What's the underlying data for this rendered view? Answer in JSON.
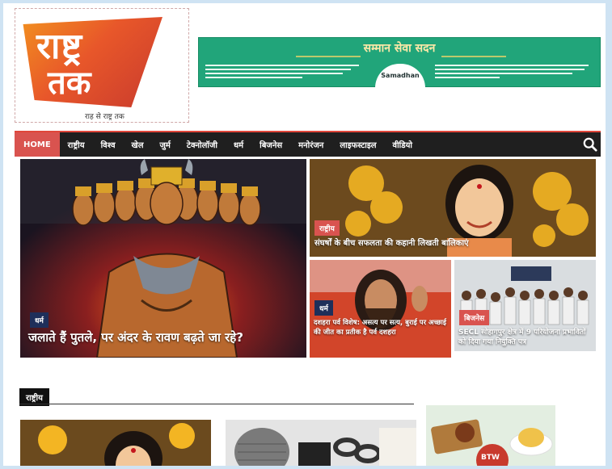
{
  "header": {
    "logo_line1": "राष्ट्र",
    "logo_line2": "तक",
    "logo_tagline": "राह से राष्ट्र तक",
    "banner": {
      "title": "सम्मान सेवा सदन",
      "logo_text": "Samadhan"
    }
  },
  "nav": {
    "home": "HOME",
    "items": [
      "राष्ट्रीय",
      "विश्व",
      "खेल",
      "जुर्म",
      "टेक्नोलॉजी",
      "धर्म",
      "बिजनेस",
      "मनोरंजन",
      "लाइफस्टाइल",
      "वीडियो"
    ],
    "search_icon": "search-icon"
  },
  "hero": {
    "main": {
      "category": "धर्म",
      "title": "जलाते हैं पुतले, पर अंदर के रावण बढ़ते जा रहे?"
    },
    "top_right": {
      "category": "राष्ट्रीय",
      "title": "संघर्षों के बीच सफलता की कहानी लिखती बालिकाएं"
    },
    "bottom_left": {
      "category": "धर्म",
      "title": "दशहरा पर्व विशेष: असत्य पर सत्य, बुराई पर अच्छाई की जीत का प्रतीक है पर्व दशहरा"
    },
    "bottom_right": {
      "category": "बिजनेस",
      "title": "SECL सोहागपुर क्षेत्र में 9 परियोजना प्रभावितों को दिया गया नियुक्ति पत्र"
    }
  },
  "section": {
    "label": "राष्ट्रीय"
  },
  "ad": {
    "badge": "BTW"
  },
  "colors": {
    "accent": "#d9534f",
    "nav_bg": "#1f1f1f",
    "banner_green": "#21a57a",
    "category_navy": "#1e2f5a"
  }
}
